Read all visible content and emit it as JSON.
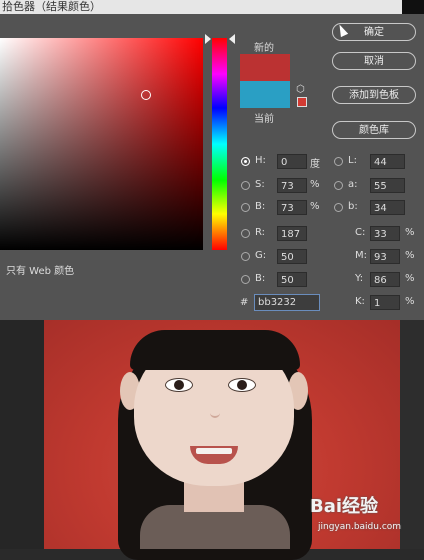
{
  "window": {
    "title": "拾色器（结果颜色）"
  },
  "new_label": "新的",
  "current_label": "当前",
  "buttons": {
    "ok": "确定",
    "cancel": "取消",
    "add_to_swatches": "添加到色板",
    "color_libraries": "颜色库"
  },
  "web_only": "只有 Web 颜色",
  "hsb": {
    "h_label": "H:",
    "h_value": "0",
    "h_unit": "度",
    "s_label": "S:",
    "s_value": "73",
    "s_unit": "%",
    "b_label": "B:",
    "b_value": "73",
    "b_unit": "%"
  },
  "rgb": {
    "r_label": "R:",
    "r_value": "187",
    "g_label": "G:",
    "g_value": "50",
    "b_label": "B:",
    "b_value": "50"
  },
  "lab": {
    "l_label": "L:",
    "l_value": "44",
    "a_label": "a:",
    "a_value": "55",
    "b_label": "b:",
    "b_value": "34"
  },
  "cmyk": {
    "c_label": "C:",
    "c_value": "33",
    "m_label": "M:",
    "m_value": "93",
    "y_label": "Y:",
    "y_value": "86",
    "k_label": "K:",
    "k_value": "1",
    "unit": "%"
  },
  "hex": {
    "label": "#",
    "value": "bb3232"
  },
  "colors": {
    "new": "#bb3232",
    "current": "#2a9fc4",
    "dialog_bg": "#535353"
  },
  "watermark": {
    "brand": "Bai经验",
    "site": "jingyan.baidu.com"
  }
}
